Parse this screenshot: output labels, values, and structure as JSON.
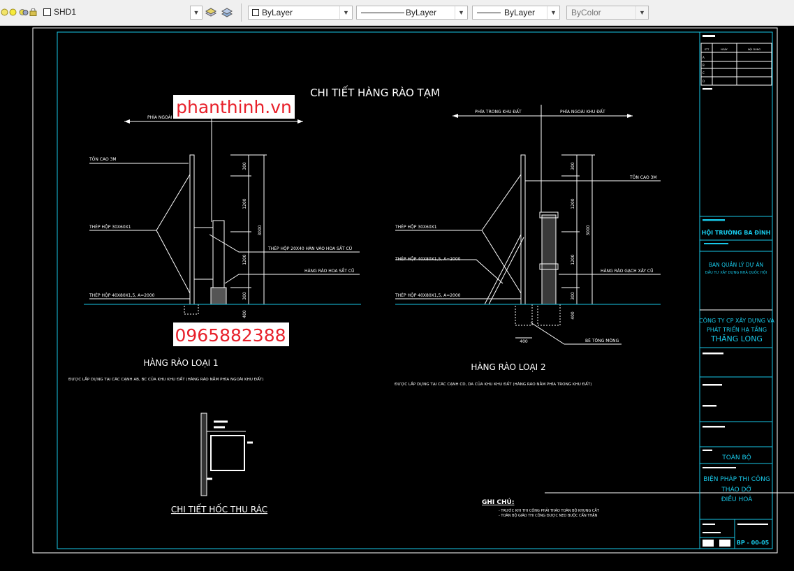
{
  "toolbar": {
    "layer_name": "SHD1",
    "color": "ByLayer",
    "linetype": "ByLayer",
    "lineweight": "ByLayer",
    "plotstyle": "ByColor"
  },
  "drawing": {
    "title": "CHI TIẾT HÀNG RÀO TẠM",
    "watermark_site": "phanthinh.vn",
    "watermark_phone": "0965882388",
    "fence1": {
      "left_side": "PHÍA NGOÀI KHU ĐẤT",
      "right_side": "PHÍA TRONG KHU ĐẤT",
      "label_ton": "TÔN CAO 3M",
      "label_thep_30": "THÉP HỘP 30X60X1",
      "label_thep_40": "THÉP HỘP 40X80X1,5, A=2000",
      "label_thep_20": "THÉP HỘP 20X40 HÀN VÀO HOA SẮT CŨ",
      "label_hoa_sat": "HÀNG RÀO HOA SẮT CŨ",
      "dims": [
        "300",
        "1200",
        "1200",
        "300",
        "3000",
        "400"
      ],
      "title": "HÀNG RÀO LOẠI 1",
      "note": "ĐƯỢC LẮP DỰNG TẠI CÁC CẠNH AB, BC CỦA KHU KHU ĐẤT (HÀNG RÀO NẰM PHÍA NGOÀI KHU ĐẤT)"
    },
    "fence2": {
      "left_side": "PHÍA TRONG KHU ĐẤT",
      "right_side": "PHÍA NGOÀI KHU ĐẤT",
      "label_ton": "TÔN CAO 3M",
      "label_thep_30": "THÉP HỘP 30X60X1",
      "label_thep_40a": "THÉP HỘP 40X80X1,5, A=2000",
      "label_thep_40b": "THÉP HỘP 40X80X1,5, A=2000",
      "label_gach": "HÀNG RÀO GẠCH XÂY CŨ",
      "label_be_tong": "BÊ TÔNG MÓNG",
      "dims": [
        "300",
        "1200",
        "1200",
        "300",
        "3000",
        "400",
        "400"
      ],
      "title": "HÀNG RÀO LOẠI 2",
      "note": "ĐƯỢC LẮP DỰNG TẠI CÁC CẠNH CD, DA CỦA KHU KHU ĐẤT (HÀNG RÀO NẰM PHÍA TRONG KHU ĐẤT)"
    },
    "trash": {
      "title": "CHI TIẾT HỐC THU RÁC"
    },
    "notes": {
      "heading": "GHI CHÚ:",
      "line1": "- TRƯỚC KHI THI CÔNG PHẢI THÁO TOÀN BỘ KHUNG CẮT",
      "line2": "- TOÀN BỘ GIÀO THI CÔNG ĐƯỢC NEO BUỘC CẨN THẬN"
    },
    "titleblock": {
      "rev_headers": [
        "STT",
        "NGÀY",
        "NỘI DUNG"
      ],
      "rev_rows": [
        "A",
        "B",
        "C",
        "D"
      ],
      "owner": "HỘI TRƯỜNG BA ĐÌNH",
      "pmu1": "BAN QUẢN LÝ DỰ ÁN",
      "pmu2": "ĐẦU TƯ XÂY DỰNG NHÀ QUỐC HỘI",
      "company1": "CÔNG TY CP XÂY DỰNG VÀ",
      "company2": "PHÁT TRIỂN HẠ TẦNG",
      "company3": "THĂNG LONG",
      "scope": "TOÀN BỘ",
      "drawing_name1": "BIỆN PHÁP THI CÔNG",
      "drawing_name2": "THÁO DỠ",
      "drawing_name3": "ĐIỀU HOÀ",
      "sheet_no": "BP - 00-05"
    }
  }
}
